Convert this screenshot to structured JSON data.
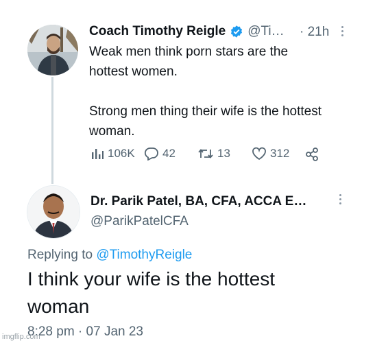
{
  "tweet": {
    "author_name": "Coach Timothy Reigle",
    "handle": "@Ti…",
    "separator": "·",
    "time": "21h",
    "text_line1": "Weak men think porn stars are the",
    "text_line2": "hottest women.",
    "text_line3": "Strong men thing their wife is the hottest",
    "text_line4": "woman.",
    "views": "106K",
    "replies": "42",
    "retweets": "13",
    "likes": "312"
  },
  "reply": {
    "author_name": "Dr. Parik Patel, BA, CFA, ACCA E…",
    "handle": "@ParikPatelCFA",
    "replying_prefix": "Replying to",
    "replying_to": "@TimothyReigle",
    "text_line1": "I think your wife is the hottest",
    "text_line2": "woman",
    "timestamp": "8:28 pm · 07 Jan 23"
  },
  "watermark": "imgflip.com",
  "colors": {
    "verified": "#1d9bf0",
    "link": "#1d9bf0",
    "muted": "#536471",
    "thread_line": "#cfd9de"
  }
}
